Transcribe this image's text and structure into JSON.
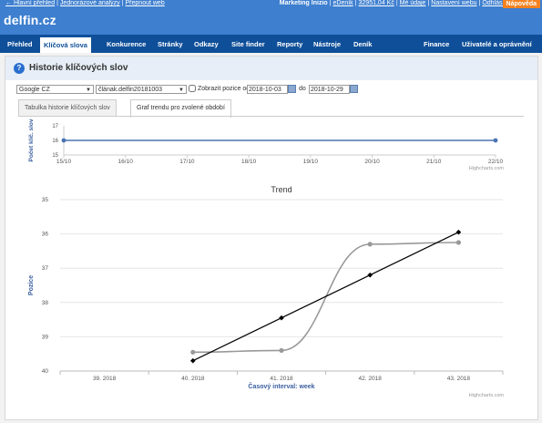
{
  "top_bar": {
    "left_links": [
      "← Hlavní přehled",
      "Jednorázové analýzy",
      "Přepnout web"
    ],
    "right_prefix": "Marketing Inizio",
    "right_links": [
      "eDeník",
      "32951,04 Kč",
      "Mé údaje",
      "Nastavení webu",
      "Odhlásit"
    ],
    "help_label": "Nápověda"
  },
  "logo": "delfin.cz",
  "nav": {
    "left": [
      "Přehled",
      "Klíčová slova",
      "Konkurence",
      "Stránky",
      "Odkazy",
      "Site finder",
      "Reporty",
      "Nástroje",
      "Deník"
    ],
    "active_index": 1,
    "right": [
      "Finance",
      "Uživatelé a oprávnění"
    ]
  },
  "panel": {
    "help_icon_glyph": "?",
    "title": "Historie klíčových slov"
  },
  "filters": {
    "engine": "Google CZ",
    "keyword_select": "člának.delfin20181003",
    "show_label": "Zobrazit pozice od",
    "date_from": "2018-10-03",
    "to_label": "do",
    "date_to": "2018-10-29"
  },
  "tabs": [
    "Tabulka historie klíčových slov",
    "Graf trendu pro zvolené období"
  ],
  "active_tab": 1,
  "chart_data": [
    {
      "type": "line",
      "ylabel": "Počet klíč. slov",
      "x": [
        "15/10",
        "16/10",
        "17/10",
        "18/10",
        "19/10",
        "20/10",
        "21/10",
        "22/10"
      ],
      "yticks": [
        15,
        16,
        17
      ],
      "ylim": [
        15,
        17
      ],
      "series": [
        {
          "values": [
            16,
            16
          ]
        }
      ],
      "series_x": [
        0,
        7
      ],
      "credit": "Highcharts.com",
      "colors": {
        "line": "#4b73b3",
        "axis_text": "#555"
      }
    },
    {
      "type": "line",
      "title": "Trend",
      "xlabel": "Časový interval: week",
      "ylabel": "Pozice",
      "categories": [
        "39. 2018",
        "40. 2018",
        "41. 2018",
        "42. 2018",
        "43. 2018"
      ],
      "y_reversed": true,
      "yticks": [
        35,
        36,
        37,
        38,
        39,
        40
      ],
      "ylim": [
        35,
        40
      ],
      "series": [
        {
          "type": "spline",
          "values": [
            null,
            39.45,
            39.4,
            36.3,
            36.25
          ],
          "color": "#999999"
        },
        {
          "type": "trend",
          "values": [
            null,
            39.7,
            38.45,
            37.2,
            35.95
          ],
          "color": "#000000"
        }
      ],
      "credit": "Highcharts.com",
      "colors": {
        "axis_title": "#3b5fa0",
        "grid": "#e6e6e6"
      }
    }
  ]
}
